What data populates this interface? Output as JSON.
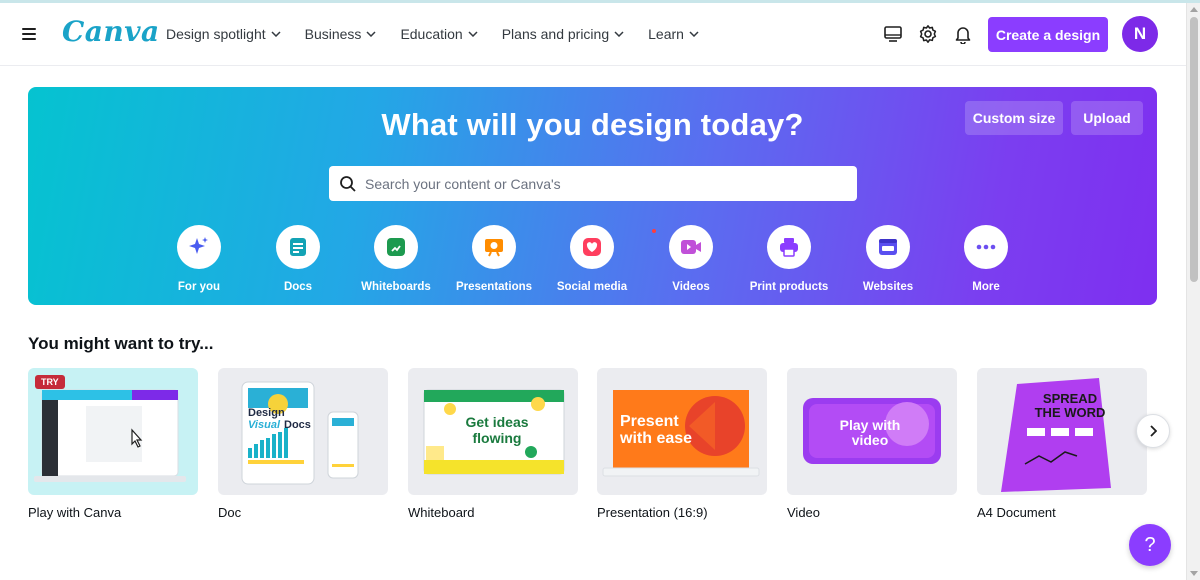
{
  "header": {
    "logo": "Canva",
    "nav": [
      {
        "label": "Design spotlight"
      },
      {
        "label": "Business"
      },
      {
        "label": "Education"
      },
      {
        "label": "Plans and pricing"
      },
      {
        "label": "Learn"
      }
    ],
    "create_label": "Create a design",
    "avatar_initial": "N",
    "icons": [
      "menu-icon",
      "desktop-icon",
      "settings-icon",
      "notifications-icon"
    ]
  },
  "hero": {
    "title": "What will you design today?",
    "custom_size_label": "Custom size",
    "upload_label": "Upload",
    "search_placeholder": "Search your content or Canva's",
    "categories": [
      {
        "label": "For you",
        "icon": "sparkle-icon",
        "color": "#4a5cf0"
      },
      {
        "label": "Docs",
        "icon": "docs-icon",
        "color": "#13a3b5"
      },
      {
        "label": "Whiteboards",
        "icon": "whiteboard-icon",
        "color": "#1d9a4f"
      },
      {
        "label": "Presentations",
        "icon": "presentation-icon",
        "color": "#ff8c00"
      },
      {
        "label": "Social media",
        "icon": "heart-icon",
        "color": "#ff3e5e"
      },
      {
        "label": "Videos",
        "icon": "video-icon",
        "color": "#c050d8"
      },
      {
        "label": "Print products",
        "icon": "printer-icon",
        "color": "#8b3dff"
      },
      {
        "label": "Websites",
        "icon": "website-icon",
        "color": "#5a4ff0"
      },
      {
        "label": "More",
        "icon": "more-icon",
        "color": "#6c4ff0"
      }
    ]
  },
  "suggestions": {
    "title": "You might want to try...",
    "try_badge": "TRY",
    "items": [
      {
        "label": "Play with Canva"
      },
      {
        "label": "Doc",
        "thumb_lines": [
          "Design",
          "Visual",
          "Docs"
        ]
      },
      {
        "label": "Whiteboard",
        "thumb_lines": [
          "Get ideas",
          "flowing"
        ]
      },
      {
        "label": "Presentation (16:9)",
        "thumb_lines": [
          "Present",
          "with ease"
        ]
      },
      {
        "label": "Video",
        "thumb_lines": [
          "Play with",
          "video"
        ]
      },
      {
        "label": "A4 Document",
        "thumb_lines": [
          "SPREAD",
          "THE WORD"
        ]
      }
    ]
  },
  "help_label": "?",
  "colors": {
    "brand_purple": "#8b3dff",
    "hero_start": "#05c3d0",
    "hero_end": "#7e2ff0"
  }
}
